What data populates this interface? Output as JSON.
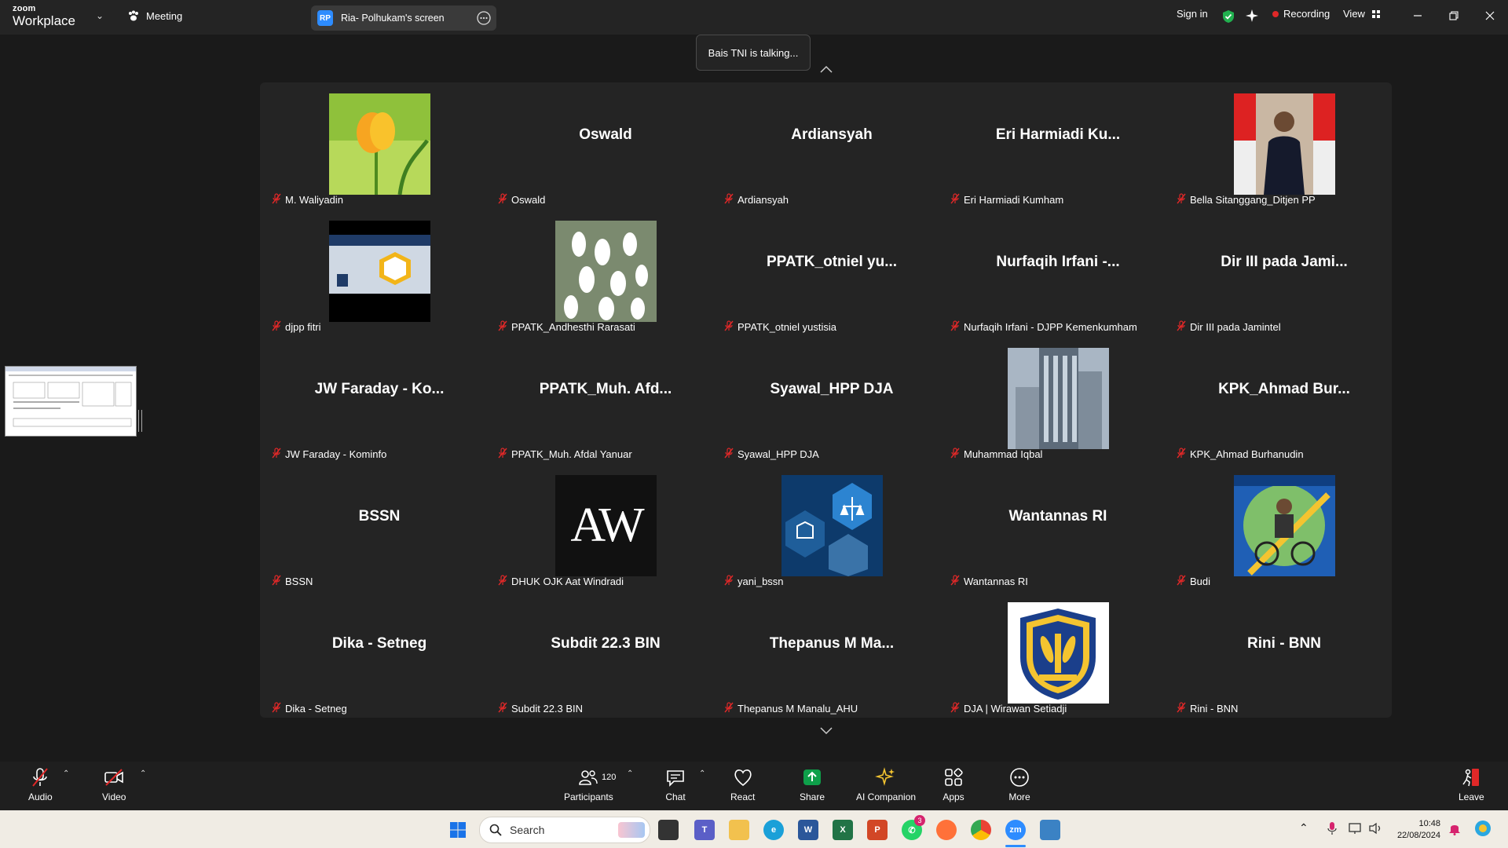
{
  "titlebar": {
    "logo_line1": "zoom",
    "logo_line2": "Workplace",
    "meeting_label": "Meeting",
    "share_badge": "RP",
    "share_title": "Ria- Polhukam's screen",
    "sign_in": "Sign in",
    "recording": "Recording",
    "view": "View"
  },
  "talking": "Bais TNI is talking...",
  "participants": [
    {
      "display": "",
      "label": "M. Waliyadin",
      "avatar": "flower-yellow"
    },
    {
      "display": "Oswald",
      "label": "Oswald"
    },
    {
      "display": "Ardiansyah",
      "label": "Ardiansyah"
    },
    {
      "display": "Eri Harmiadi Ku...",
      "label": "Eri Harmiadi Kumham"
    },
    {
      "display": "",
      "label": "Bella Sitanggang_Ditjen PP",
      "avatar": "portrait"
    },
    {
      "display": "",
      "label": "djpp fitri",
      "avatar": "poster"
    },
    {
      "display": "",
      "label": "PPATK_Andhesthi Rarasati",
      "avatar": "flower-white"
    },
    {
      "display": "PPATK_otniel  yu...",
      "label": "PPATK_otniel yustisia"
    },
    {
      "display": "Nurfaqih Irfani -...",
      "label": "Nurfaqih Irfani - DJPP Kemenkumham"
    },
    {
      "display": "Dir III pada Jami...",
      "label": "Dir III pada Jamintel"
    },
    {
      "display": "JW Faraday - Ko...",
      "label": "JW Faraday - Kominfo"
    },
    {
      "display": "PPATK_Muh.  Afd...",
      "label": "PPATK_Muh. Afdal Yanuar"
    },
    {
      "display": "Syawal_HPP DJA",
      "label": "Syawal_HPP DJA"
    },
    {
      "display": "",
      "label": "Muhammad Iqbal",
      "avatar": "building"
    },
    {
      "display": "KPK_Ahmad  Bur...",
      "label": "KPK_Ahmad Burhanudin"
    },
    {
      "display": "BSSN",
      "label": "BSSN"
    },
    {
      "display": "",
      "label": "DHUK OJK Aat Windradi",
      "avatar": "aw-logo",
      "avatar_text": "AW"
    },
    {
      "display": "",
      "label": "yani_bssn",
      "avatar": "justice"
    },
    {
      "display": "Wantannas RI",
      "label": "Wantannas RI"
    },
    {
      "display": "",
      "label": "Budi",
      "avatar": "cyclist"
    },
    {
      "display": "Dika - Setneg",
      "label": "Dika - Setneg"
    },
    {
      "display": "Subdit 22.3 BIN",
      "label": "Subdit 22.3 BIN"
    },
    {
      "display": "Thepanus M Ma...",
      "label": "Thepanus M Manalu_AHU"
    },
    {
      "display": "",
      "label": "DJA | Wirawan Setiadji",
      "avatar": "kemenkeu"
    },
    {
      "display": "Rini - BNN",
      "label": "Rini - BNN"
    }
  ],
  "toolbar": {
    "audio": "Audio",
    "video": "Video",
    "participants": "Participants",
    "participants_count": "120",
    "chat": "Chat",
    "react": "React",
    "share": "Share",
    "ai_companion": "AI Companion",
    "apps": "Apps",
    "more": "More",
    "leave": "Leave"
  },
  "taskbar": {
    "search_placeholder": "Search",
    "whatsapp_badge": "3",
    "time": "10:48",
    "date": "22/08/2024"
  },
  "colors": {
    "share_green": "#0e9f4a",
    "zoom_blue": "#2d8cff",
    "muted_red": "#e02828"
  }
}
